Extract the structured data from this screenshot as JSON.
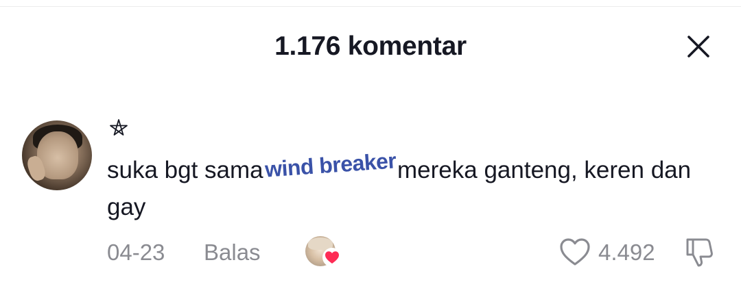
{
  "header": {
    "title": "1.176 komentar",
    "close_icon": "close-icon"
  },
  "comment": {
    "avatar_icon": "user-avatar",
    "badge_icon": "pentagram-icon",
    "text_before": "suka bgt sama",
    "sticker_text": "wind breaker",
    "text_after": "mereka ganteng, keren dan gay",
    "date": "04-23",
    "reply_label": "Balas",
    "liked_by_icon": "liker-avatar-heart",
    "like_count": "4.492",
    "like_icon": "heart-outline-icon",
    "dislike_icon": "thumbs-down-icon"
  },
  "colors": {
    "primary_text": "#161823",
    "secondary_text": "#8a8b91",
    "sticker": "#3a52a8",
    "heart": "#fe2c55"
  }
}
